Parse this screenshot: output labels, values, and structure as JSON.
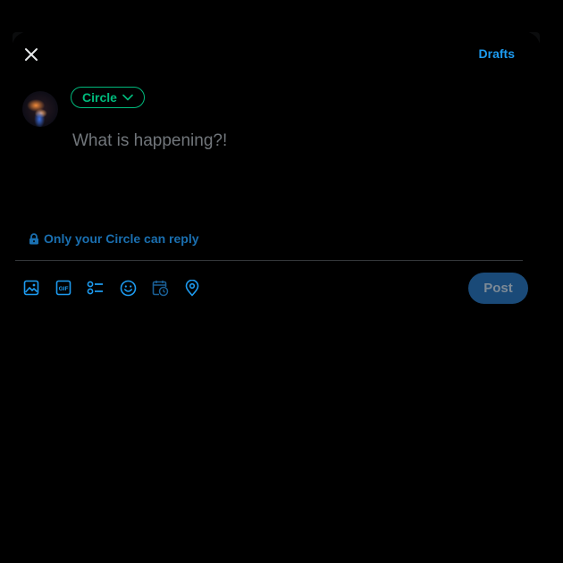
{
  "header": {
    "close_icon": "close-icon",
    "drafts_label": "Drafts"
  },
  "composer": {
    "audience_label": "Circle",
    "audience_icon": "chevron-down-icon",
    "placeholder": "What is happening?!",
    "value": "",
    "reply_setting_label": "Only your Circle can reply",
    "reply_setting_icon": "lock-icon"
  },
  "toolbar": {
    "tools": [
      {
        "name": "media",
        "icon": "image-icon"
      },
      {
        "name": "gif",
        "icon": "gif-icon",
        "label": "GIF"
      },
      {
        "name": "poll",
        "icon": "poll-icon"
      },
      {
        "name": "emoji",
        "icon": "emoji-icon"
      },
      {
        "name": "schedule",
        "icon": "schedule-icon"
      },
      {
        "name": "location",
        "icon": "location-icon"
      }
    ],
    "post_label": "Post"
  },
  "colors": {
    "accent": "#1d9bf0",
    "circle_green": "#00ba7c",
    "post_disabled_bg": "#1a4a78",
    "placeholder": "#71767b"
  }
}
